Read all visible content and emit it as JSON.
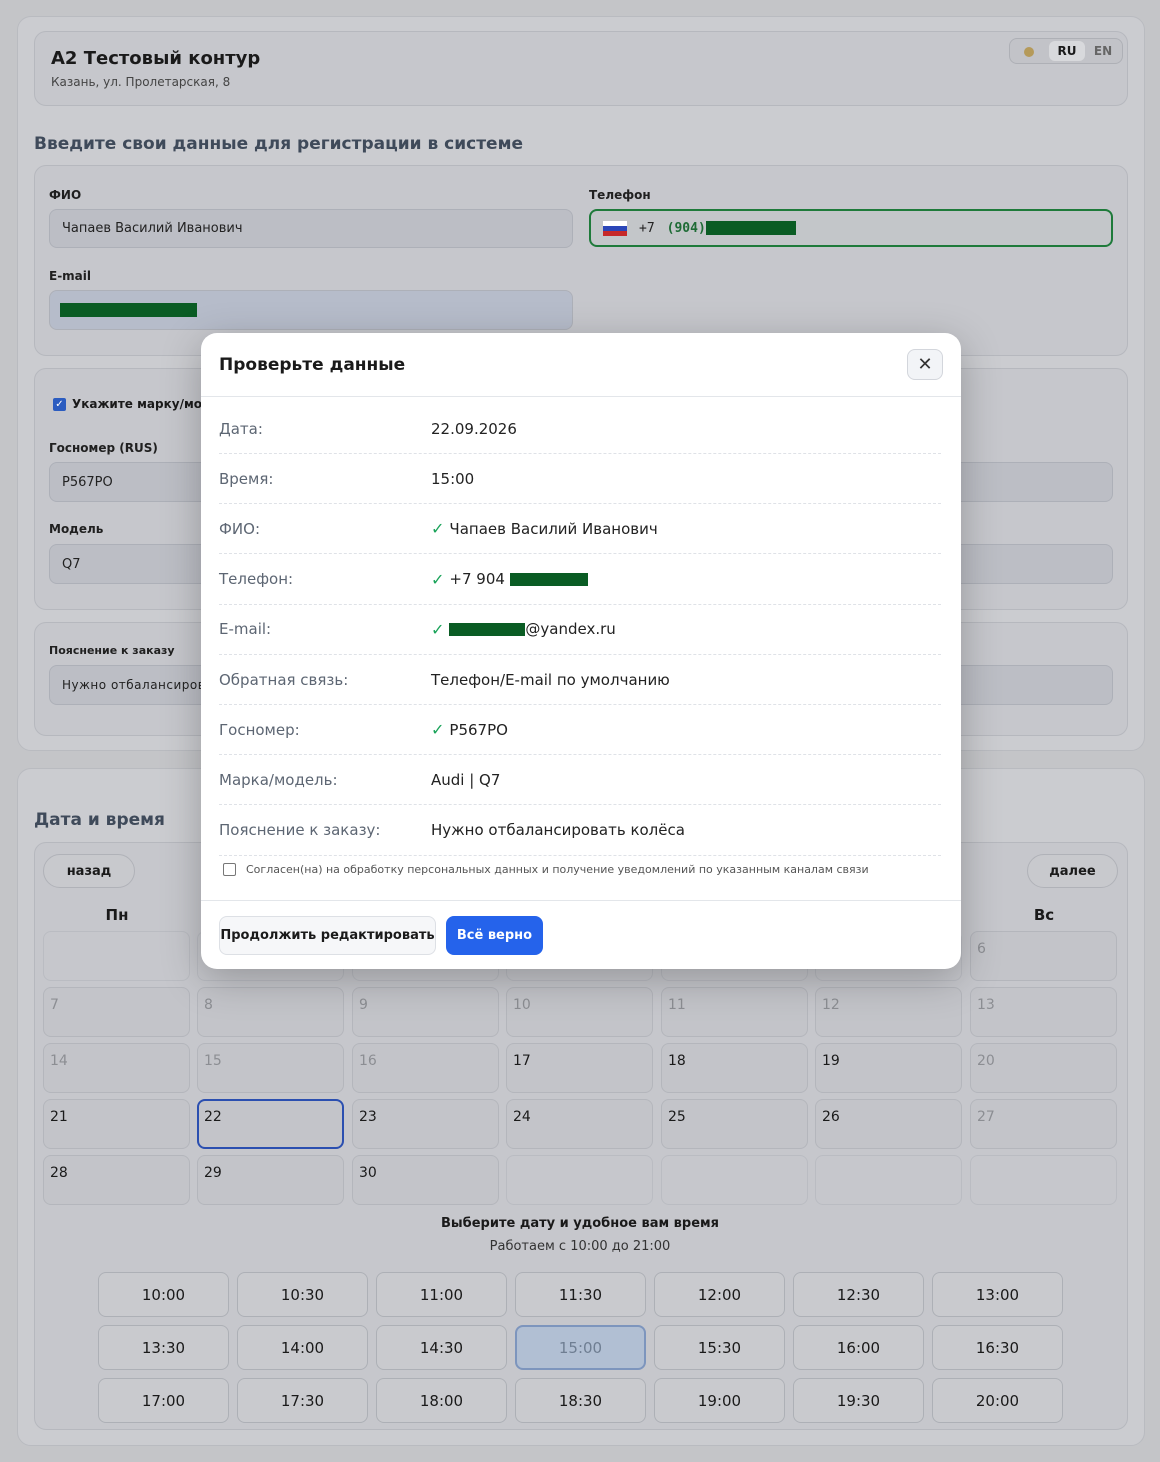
{
  "header": {
    "title": "A2 Тестовый контур",
    "address": "Казань, ул. Пролетарская, 8",
    "lang_active": "RU",
    "lang_other": "EN"
  },
  "form": {
    "heading": "Введите свои данные для регистрации в системе",
    "fio_label": "ФИО",
    "fio_value": "Чапаев Василий Иванович",
    "phone_label": "Телефон",
    "phone_prefix": "+7",
    "phone_code": "(904)",
    "email_label": "E-mail"
  },
  "car": {
    "checkbox_label": "Укажите марку/модель",
    "plate_label": "Госномер (RUS)",
    "plate_value": "Р567РО",
    "model_label": "Модель",
    "model_value": "Q7"
  },
  "note": {
    "label": "Пояснение к заказу",
    "value": "Нужно отбалансирова"
  },
  "calendar": {
    "heading": "Дата и время",
    "prev": "назад",
    "next": "далее",
    "day_mon": "Пн",
    "day_sun": "Вс",
    "rows": [
      [
        {
          "t": "",
          "k": "empty"
        },
        {
          "t": "",
          "k": "empty"
        },
        {
          "t": "",
          "k": "empty"
        },
        {
          "t": "",
          "k": "empty"
        },
        {
          "t": "",
          "k": "empty"
        },
        {
          "t": "",
          "k": "empty"
        },
        {
          "t": "6",
          "k": "dis"
        }
      ],
      [
        {
          "t": "7",
          "k": "dis"
        },
        {
          "t": "8",
          "k": "dis"
        },
        {
          "t": "9",
          "k": "dis"
        },
        {
          "t": "10",
          "k": "dis"
        },
        {
          "t": "11",
          "k": "dis"
        },
        {
          "t": "12",
          "k": "dis"
        },
        {
          "t": "13",
          "k": "dis"
        }
      ],
      [
        {
          "t": "14",
          "k": "dis"
        },
        {
          "t": "15",
          "k": "dis"
        },
        {
          "t": "16",
          "k": "dis"
        },
        {
          "t": "17",
          "k": ""
        },
        {
          "t": "18",
          "k": ""
        },
        {
          "t": "19",
          "k": ""
        },
        {
          "t": "20",
          "k": "dis"
        }
      ],
      [
        {
          "t": "21",
          "k": ""
        },
        {
          "t": "22",
          "k": "sel"
        },
        {
          "t": "23",
          "k": ""
        },
        {
          "t": "24",
          "k": ""
        },
        {
          "t": "25",
          "k": ""
        },
        {
          "t": "26",
          "k": ""
        },
        {
          "t": "27",
          "k": "dis"
        }
      ],
      [
        {
          "t": "28",
          "k": ""
        },
        {
          "t": "29",
          "k": ""
        },
        {
          "t": "30",
          "k": ""
        },
        {
          "t": "",
          "k": "empty"
        },
        {
          "t": "",
          "k": "empty"
        },
        {
          "t": "",
          "k": "empty"
        },
        {
          "t": "",
          "k": "empty"
        }
      ]
    ],
    "hint": "Выберите дату и удобное вам время",
    "hours": "Работаем с 10:00 до 21:00",
    "slots": [
      "10:00",
      "10:30",
      "11:00",
      "11:30",
      "12:00",
      "12:30",
      "13:00",
      "13:30",
      "14:00",
      "14:30",
      "15:00",
      "15:30",
      "16:00",
      "16:30",
      "17:00",
      "17:30",
      "18:00",
      "18:30",
      "19:00",
      "19:30",
      "20:00"
    ],
    "selected_slot": "15:00"
  },
  "modal": {
    "title": "Проверьте данные",
    "rows": [
      {
        "k": "Дата:",
        "v": "22.09.2026",
        "check": false,
        "redact": 0,
        "suffix": ""
      },
      {
        "k": "Время:",
        "v": "15:00",
        "check": false,
        "redact": 0,
        "suffix": ""
      },
      {
        "k": "ФИО:",
        "v": "Чапаев Василий Иванович",
        "check": true,
        "redact": 0,
        "suffix": ""
      },
      {
        "k": "Телефон:",
        "v": "+7 904",
        "check": true,
        "redact": 78,
        "suffix": ""
      },
      {
        "k": "E-mail:",
        "v": "",
        "check": true,
        "redact": 76,
        "suffix": "@yandex.ru"
      },
      {
        "k": "Обратная связь:",
        "v": "Телефон/E-mail по умолчанию",
        "check": false,
        "redact": 0,
        "suffix": ""
      },
      {
        "k": "Госномер:",
        "v": "Р567РО",
        "check": true,
        "redact": 0,
        "suffix": ""
      },
      {
        "k": "Марка/модель:",
        "v": "Audi | Q7",
        "check": false,
        "redact": 0,
        "suffix": ""
      },
      {
        "k": "Пояснение к заказу:",
        "v": "Нужно отбалансировать колёса",
        "check": false,
        "redact": 0,
        "suffix": ""
      }
    ],
    "consent": "Согласен(на) на обработку персональных данных и получение уведомлений по указанным каналам связи",
    "btn_edit": "Продолжить редактировать",
    "btn_ok": "Всё верно"
  },
  "colors": {
    "primary": "#2563eb",
    "check": "#1aa35a",
    "redaction": "#0a5c24"
  }
}
